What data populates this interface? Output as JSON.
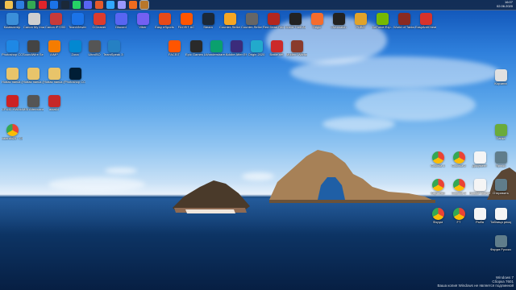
{
  "taskbar": {
    "apps": [
      {
        "name": "explorer-icon",
        "color": "#f2c14e"
      },
      {
        "name": "windows-icon",
        "color": "#2d7de0"
      },
      {
        "name": "chrome-icon",
        "color": "#34a853"
      },
      {
        "name": "opera-icon",
        "color": "#e0242a"
      },
      {
        "name": "teamviewer-icon",
        "color": "#1b73e8"
      },
      {
        "name": "steam-icon",
        "color": "#1b2838"
      },
      {
        "name": "whatsapp-icon",
        "color": "#25d366"
      },
      {
        "name": "discord-icon",
        "color": "#5865f2"
      },
      {
        "name": "foxit-icon",
        "color": "#e55a2b"
      },
      {
        "name": "photoshop-icon",
        "color": "#31a8ff"
      },
      {
        "name": "aftereffects-icon",
        "color": "#9999ff"
      },
      {
        "name": "media-icon",
        "color": "#f06c1e"
      },
      {
        "name": "window-active-icon",
        "color": "#b9772b"
      }
    ],
    "time": "16:07",
    "date": "02.06.2020"
  },
  "desktop": {
    "icons": [
      {
        "name": "computer-icon",
        "label": "Компьютер",
        "color": "#3b8fd9"
      },
      {
        "name": "canon-mg-icon",
        "label": "Canon My Image G...",
        "color": "#cfcfcf"
      },
      {
        "name": "canon-ip-icon",
        "label": "Canon iP7200 series MG",
        "color": "#c73a3a"
      },
      {
        "name": "teamviewer-icon",
        "label": "TeamViewer",
        "color": "#1b73e8"
      },
      {
        "name": "ccleaner-icon",
        "label": "CCleaner",
        "color": "#dd3b2d"
      },
      {
        "name": "discord-icon",
        "label": "Discord",
        "color": "#5865f2"
      },
      {
        "name": "viber-icon",
        "label": "Viber",
        "color": "#7360f2"
      },
      {
        "name": "easysports-icon",
        "label": "Easy eSports",
        "color": "#e64a19"
      },
      {
        "name": "faceit-icon",
        "label": "FACEIT AC",
        "color": "#ff5500"
      },
      {
        "name": "steam-icon",
        "label": "Steam",
        "color": "#1b2838"
      },
      {
        "name": "counter-strike-icon",
        "label": "Counter-Strike...",
        "color": "#f5a623"
      },
      {
        "name": "csgo-icon",
        "label": "Counter-Strike Global Offen...",
        "color": "#666666"
      },
      {
        "name": "rdr2-icon",
        "label": "Red Dead Redemption 2",
        "color": "#b3261e"
      },
      {
        "name": "gta-icon",
        "label": "Grand Theft Auto V",
        "color": "#222222"
      },
      {
        "name": "origin-icon",
        "label": "Origin",
        "color": "#f56c2d"
      },
      {
        "name": "overwatch-icon",
        "label": "Overwatch",
        "color": "#222222"
      },
      {
        "name": "pubg-icon",
        "label": "PUBG",
        "color": "#e1a32a"
      },
      {
        "name": "nvidia-icon",
        "label": "GeForce Exp...",
        "color": "#76b900"
      },
      {
        "name": "wot-icon",
        "label": "World of Tanks",
        "color": "#8a2a20"
      },
      {
        "name": "easyanticheat-icon",
        "label": "EasyAntiCheat",
        "color": "#d8322b"
      },
      {
        "name": "photoshop-cc-icon",
        "label": "Photoshop CC 64",
        "color": "#1e88e5"
      },
      {
        "name": "soundwire-icon",
        "label": "SoundWire Server",
        "color": "#444444"
      },
      {
        "name": "aimp-icon",
        "label": "AIMP",
        "color": "#f57c00"
      },
      {
        "name": "zona-icon",
        "label": "Zona",
        "color": "#0288d1"
      },
      {
        "name": "ultraiso-icon",
        "label": "UltraISO",
        "color": "#555555"
      },
      {
        "name": "teamspeak-icon",
        "label": "TeamSpeak 3 Client",
        "color": "#2580c3"
      },
      {
        "name": "faceit-2-icon",
        "label": "FACEIT",
        "color": "#ff5500"
      },
      {
        "name": "epic-icon",
        "label": "Epic Games Launcher",
        "color": "#2a2a2a"
      },
      {
        "name": "wondershare-icon",
        "label": "Wondershare Filmora",
        "color": "#0aa06e"
      },
      {
        "name": "ae-icon",
        "label": "Adobe After Effects 2020",
        "color": "#3b2c7b"
      },
      {
        "name": "origin-2-icon",
        "label": "Origin 2020",
        "color": "#22aacc"
      },
      {
        "name": "battlenet-icon",
        "label": "Battle.net",
        "color": "#cc2a2a"
      },
      {
        "name": "mw-icon",
        "label": "Modern Warfare 2020",
        "color": "#8a3b2c"
      },
      {
        "name": "folder-1-icon",
        "label": "Новая папка (4)",
        "color": "#e8c46a"
      },
      {
        "name": "folder-2-icon",
        "label": "Новая папка (2)",
        "color": "#e8c46a"
      },
      {
        "name": "folder-3-icon",
        "label": "Новая папка (3)",
        "color": "#e8c46a"
      },
      {
        "name": "photoshop-cc-2-icon",
        "label": "Photoshop CC",
        "color": "#001e36"
      },
      {
        "name": "cpuid-icon",
        "label": "CPUID HWMonitor",
        "color": "#cc2222"
      },
      {
        "name": "gpu-afterburner-icon",
        "label": "MSI Afterburner",
        "color": "#555555"
      },
      {
        "name": "aida64-icon",
        "label": "aida64",
        "color": "#c62828"
      },
      {
        "name": "chrome-user-icon",
        "label": "valentin25 - Chrome",
        "color": "#34a853"
      },
      {
        "name": "recycle-bin-icon",
        "label": "Корзина",
        "color": "#e0e0e0"
      },
      {
        "name": "folder-right-icon",
        "label": "Папка",
        "color": "#6aab3a"
      },
      {
        "name": "chrome-right-1-icon",
        "label": "Ссылка 1",
        "color": "#34a853"
      },
      {
        "name": "chrome-right-2-icon",
        "label": "Ссылка 2",
        "color": "#34a853"
      },
      {
        "name": "document-1-icon",
        "label": "Документ",
        "color": "#f5f5f5"
      },
      {
        "name": "shortcut-1-icon",
        "label": "Ярлык",
        "color": "#607d8b"
      },
      {
        "name": "chrome-right-3-icon",
        "label": "Картинки",
        "color": "#34a853"
      },
      {
        "name": "chrome-right-4-icon",
        "label": "Ссылка 3",
        "color": "#34a853"
      },
      {
        "name": "document-2-icon",
        "label": "Новый текстовый",
        "color": "#f5f5f5"
      },
      {
        "name": "shortcut-2-icon",
        "label": "Отправить",
        "color": "#607d8b"
      },
      {
        "name": "chrome-right-5-icon",
        "label": "Форум",
        "color": "#34a853"
      },
      {
        "name": "chrome-right-6-icon",
        "label": "FT",
        "color": "#34a853"
      },
      {
        "name": "document-3-icon",
        "label": "Рыба",
        "color": "#f5f5f5"
      },
      {
        "name": "document-4-icon",
        "label": "Таблица рекордов",
        "color": "#f5f5f5"
      },
      {
        "name": "forum-icon",
        "label": "Форум Русско...",
        "color": "#607d8b"
      }
    ]
  },
  "watermark": {
    "line1": "Windows 7",
    "line2": "Сборка 7601",
    "line3": "Ваша копия Windows не является подлинной"
  }
}
